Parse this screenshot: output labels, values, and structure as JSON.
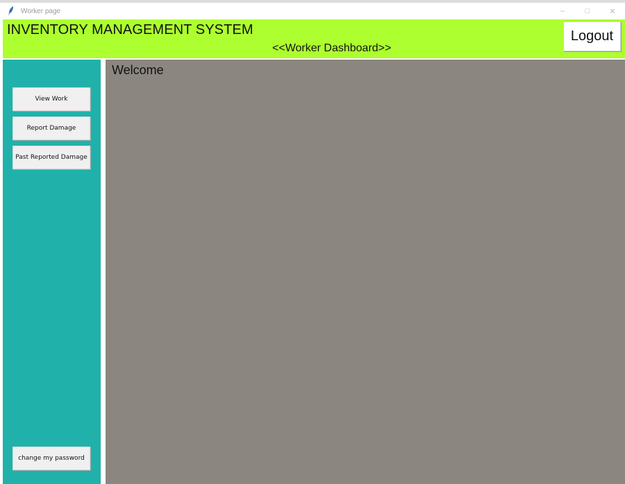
{
  "window": {
    "title": "Worker page",
    "controls": {
      "minimize": "–",
      "maximize": "□",
      "close": "✕"
    }
  },
  "header": {
    "app_title": "INVENTORY MANAGEMENT SYSTEM",
    "dashboard_title": "<<Worker Dashboard>>",
    "logout_label": "Logout"
  },
  "sidebar": {
    "items": [
      {
        "label": "View Work"
      },
      {
        "label": "Report Damage"
      },
      {
        "label": "Past Reported Damage"
      }
    ],
    "change_password_label": "change my password"
  },
  "main": {
    "welcome_text": "Welcome"
  },
  "colors": {
    "header_bg": "#adff2f",
    "sidebar_bg": "#20b2aa",
    "main_bg": "#8b8680",
    "button_bg": "#f0f0f0"
  },
  "icons": {
    "app": "feather-icon"
  }
}
